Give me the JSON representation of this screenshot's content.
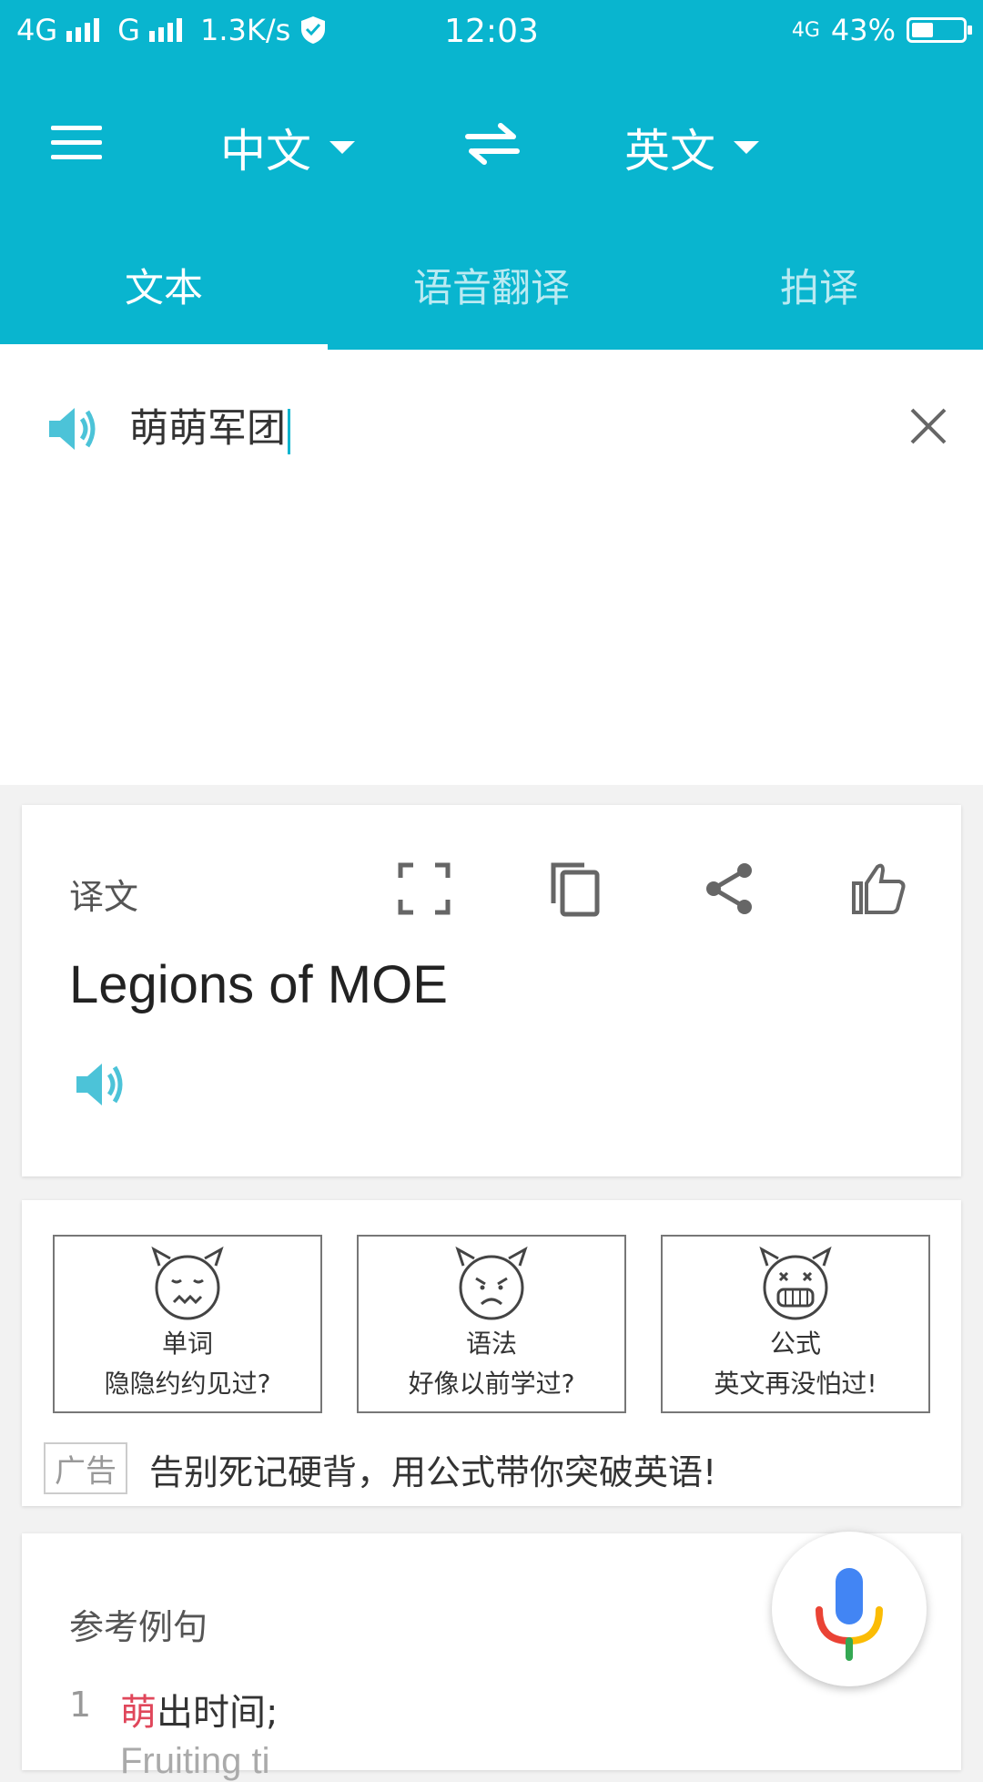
{
  "status_bar": {
    "network1": "4G",
    "network2": "G",
    "speed": "1.3K/s",
    "time": "12:03",
    "network_right": "4G",
    "battery_percent": "43%",
    "battery_level": 0.43
  },
  "toolbar": {
    "source_lang": "中文",
    "target_lang": "英文"
  },
  "tabs": [
    {
      "label": "文本",
      "active": true
    },
    {
      "label": "语音翻译",
      "active": false
    },
    {
      "label": "拍译",
      "active": false
    }
  ],
  "input": {
    "text": "萌萌军团"
  },
  "translation_card": {
    "label": "译文",
    "result": "Legions of MOE"
  },
  "ad_card": {
    "promos": [
      {
        "title": "单词",
        "subtitle": "隐隐约约见过?"
      },
      {
        "title": "语法",
        "subtitle": "好像以前学过?"
      },
      {
        "title": "公式",
        "subtitle": "英文再没怕过!"
      }
    ],
    "badge": "广告",
    "text": "告别死记硬背，用公式带你突破英语!"
  },
  "examples_card": {
    "label": "参考例句",
    "items": [
      {
        "index": "1",
        "highlight": "萌",
        "rest": "出时间;",
        "sub": "Fruiting ti"
      }
    ]
  },
  "colors": {
    "accent": "#09b5cf",
    "highlight": "#e0475b"
  }
}
